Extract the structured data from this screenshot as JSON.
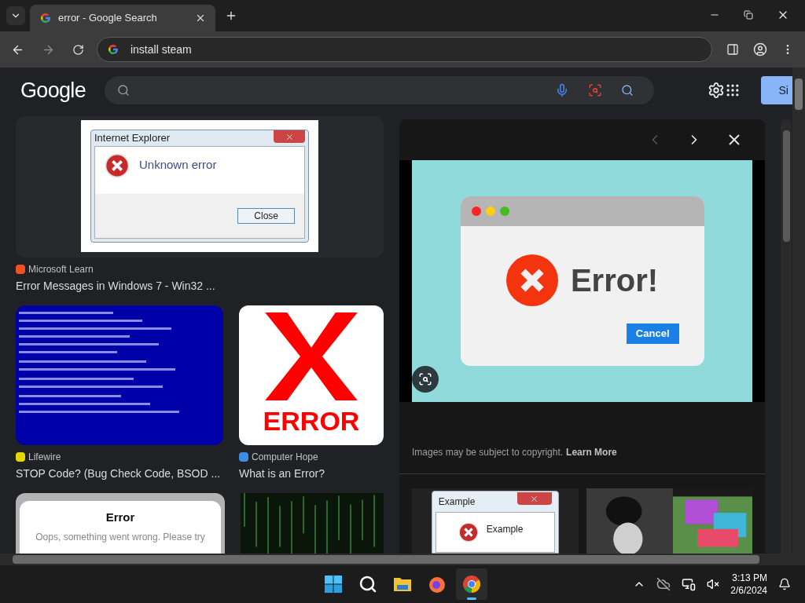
{
  "tabs": [
    {
      "title": "error - Google Search",
      "selected": true
    }
  ],
  "address_bar": {
    "value": "install steam"
  },
  "header": {
    "logo": "Google",
    "sign_in": "Si"
  },
  "results": [
    {
      "kind": "dialog",
      "source": "Microsoft Learn",
      "title": "Error Messages in Windows 7 - Win32 ...",
      "image": {
        "window_title": "Internet Explorer",
        "message": "Unknown error",
        "button": "Close"
      }
    },
    {
      "kind": "bsod",
      "source": "Lifewire",
      "title": "STOP Code? (Bug Check Code, BSOD ..."
    },
    {
      "kind": "x-mark",
      "source": "Computer Hope",
      "title": "What is an Error?",
      "image": {
        "caption": "ERROR"
      }
    },
    {
      "kind": "card",
      "image": {
        "heading": "Error",
        "message": "Oops, something went wrong. Please try"
      }
    },
    {
      "kind": "matrix"
    }
  ],
  "preview": {
    "nav": {
      "previous_disabled": true
    },
    "image": {
      "message": "Error!",
      "button": "Cancel"
    },
    "notice": "Images may be subject to copyright.",
    "link": "Learn More",
    "related": [
      {
        "kind": "dialog",
        "window_title": "Example",
        "message": "Example"
      },
      {
        "kind": "picture"
      }
    ]
  },
  "taskbar": {
    "apps": [
      {
        "kind": "start",
        "running": false
      },
      {
        "kind": "search",
        "running": false
      },
      {
        "kind": "files",
        "running": false
      },
      {
        "kind": "firefox",
        "running": false
      },
      {
        "kind": "chrome",
        "running": true
      }
    ],
    "clock": {
      "time": "3:13 PM",
      "date": "2/6/2024"
    }
  }
}
